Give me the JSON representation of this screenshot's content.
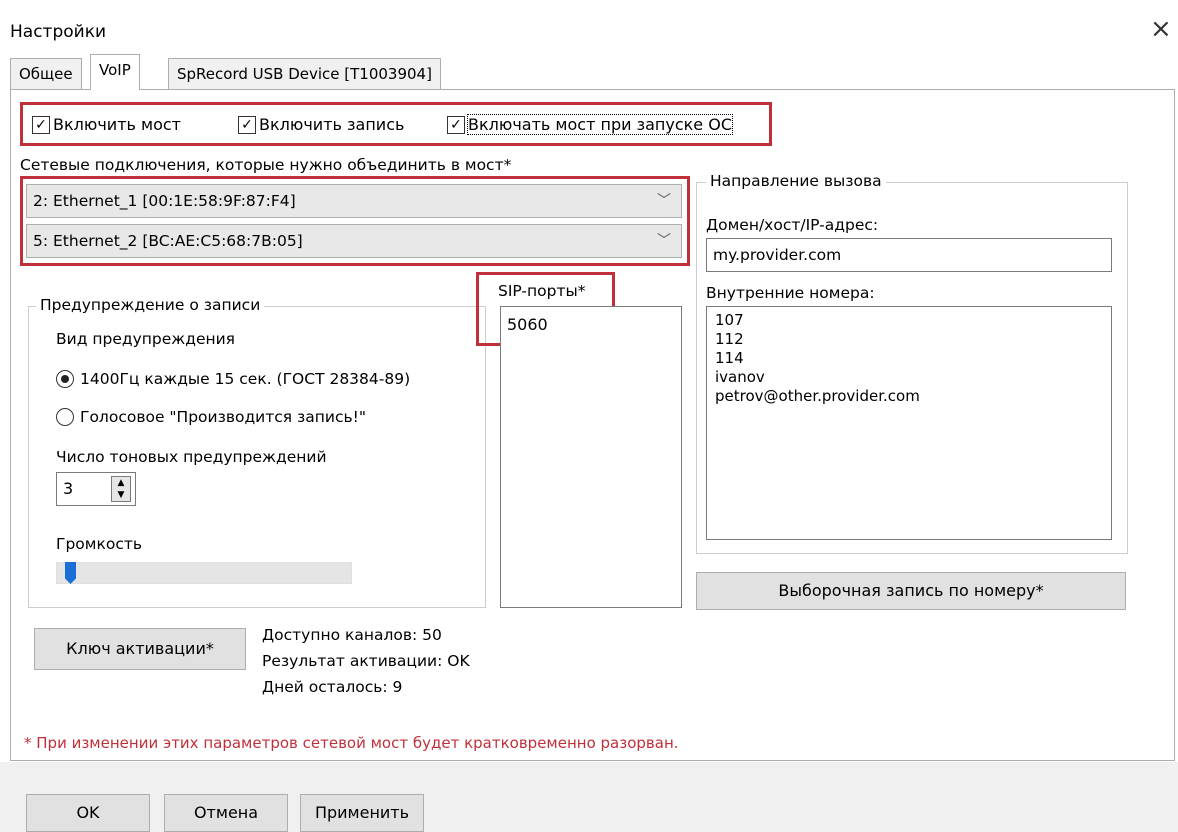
{
  "window": {
    "title": "Настройки",
    "close_symbol": "×"
  },
  "tabs": [
    {
      "label": "Общее",
      "active": false
    },
    {
      "label": "VoIP",
      "active": true
    },
    {
      "label": "SpRecord USB Device [T1003904]",
      "active": false
    }
  ],
  "checkboxes": [
    {
      "label": "Включить мост",
      "checked": true
    },
    {
      "label": "Включить запись",
      "checked": true
    },
    {
      "label": "Включать мост при запуске ОС",
      "checked": true
    }
  ],
  "network": {
    "label": "Сетевые подключения, которые нужно объединить в мост*",
    "connections": [
      "2: Ethernet_1 [00:1E:58:9F:87:F4]",
      "5: Ethernet_2 [BC:AE:C5:68:7B:05]"
    ]
  },
  "warning_group": {
    "legend": "Предупреждение о записи",
    "type_label": "Вид предупреждения",
    "options": [
      {
        "label": "1400Гц каждые 15 сек. (ГОСТ 28384-89)",
        "selected": true
      },
      {
        "label": "Голосовое \"Производится запись!\"",
        "selected": false
      }
    ],
    "tone_count_label": "Число тоновых предупреждений",
    "tone_count_value": "3",
    "volume_label": "Громкость",
    "volume_level": 0.03
  },
  "sip": {
    "label": "SIP-порты*",
    "ports": [
      "5060"
    ]
  },
  "call_direction": {
    "legend": "Направление вызова",
    "domain_label": "Домен/хост/IP-адрес:",
    "domain_value": "my.provider.com",
    "numbers_label": "Внутренние номера:",
    "numbers": [
      "107",
      "112",
      "114",
      "ivanov",
      "petrov@other.provider.com"
    ],
    "selective_button": "Выборочная запись по номеру*"
  },
  "activation": {
    "button": "Ключ активации*",
    "channels": "Доступно каналов: 50",
    "result": "Результат активации: OK",
    "days": "Дней осталось: 9"
  },
  "footnote": "* При изменении этих параметров сетевой мост будет кратковременно разорван.",
  "footer_buttons": {
    "ok": "OK",
    "cancel": "Отмена",
    "apply": "Применить"
  },
  "colors": {
    "highlight": "#c0303a",
    "slider_thumb": "#1a6fd6"
  }
}
